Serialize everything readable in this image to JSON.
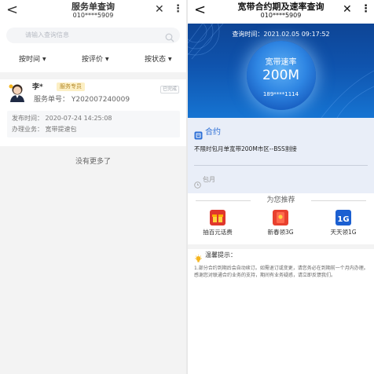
{
  "left": {
    "header": {
      "back": "<",
      "title": "服务单查询",
      "subtitle": "010****5909",
      "close": "✕",
      "more": "⋮"
    },
    "search": {
      "placeholder": "请输入查询信息"
    },
    "filters": [
      {
        "label": "按时间"
      },
      {
        "label": "按评价"
      },
      {
        "label": "按状态"
      }
    ],
    "order": {
      "name": "李*",
      "badge": "服务专员",
      "status": "已完成",
      "service_no": "服务单号：  Y202007240009",
      "publish_time": "发布时间：  2020-07-24 14:25:08",
      "business": "办理业务：  宽带提速包"
    },
    "footer": "没有更多了"
  },
  "right": {
    "header": {
      "back": "<",
      "title": "宽带合约期及速率查询",
      "subtitle": "010****5909",
      "close": "✕",
      "more": "⋮"
    },
    "query_time": "查询时间：2021.02.05 09:17:52",
    "speed": {
      "label": "宽带速率",
      "value": "200M",
      "account": "189****1114"
    },
    "contract": {
      "title": "合约",
      "description": "不限时包月单宽带200M市区--BSS割接",
      "period": "包月"
    },
    "recommend": {
      "title": "为您推荐",
      "items": [
        {
          "label": "抽百元话费",
          "icon": "gift-icon",
          "color": "#e0372c"
        },
        {
          "label": "新春领3G",
          "icon": "red-envelope-icon",
          "color": "#e8412f"
        },
        {
          "label": "天天领1G",
          "icon": "data-1g-icon",
          "color": "#1b5fd1"
        }
      ]
    },
    "tips": {
      "title": "温馨提示：",
      "body": "1.部分合约到期后会自动续订。如需退订或变更，请您务必在到期前一个月内办理。感谢您对联通合约业务的支持，期间有业务疑惑，请立即反馈我们。"
    }
  }
}
